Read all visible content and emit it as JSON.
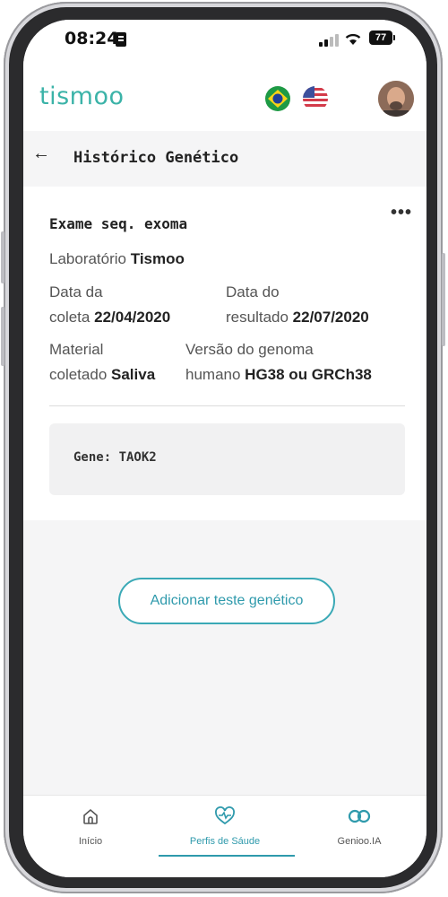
{
  "status_bar": {
    "time": "08:24",
    "battery": "77"
  },
  "app": {
    "logo": "tismoo"
  },
  "page": {
    "title": "Histórico Genético"
  },
  "exam": {
    "title": "Exame seq. exoma",
    "lab_label": "Laboratório",
    "lab_value": "Tismoo",
    "collect_label_1": "Data da",
    "collect_label_2": "coleta",
    "collect_value": "22/04/2020",
    "result_label_1": "Data do",
    "result_label_2": "resultado",
    "result_value": "22/07/2020",
    "material_label_1": "Material",
    "material_label_2": "coletado",
    "material_value": "Saliva",
    "genome_label_1": "Versão do genoma",
    "genome_label_2": "humano",
    "genome_value": "HG38 ou GRCh38",
    "gene_text": "Gene: TAOK2",
    "more_icon": "more-horizontal-icon"
  },
  "actions": {
    "add_label": "Adicionar teste genético"
  },
  "nav": {
    "items": [
      {
        "label": "Início",
        "icon": "home-icon"
      },
      {
        "label": "Perfis de Sáude",
        "icon": "heart-pulse-icon"
      },
      {
        "label": "Genioo.IA",
        "icon": "infinity-icon"
      }
    ],
    "active_index": 1
  },
  "colors": {
    "accent": "#2f9aac",
    "logo": "#3bb3a8"
  }
}
